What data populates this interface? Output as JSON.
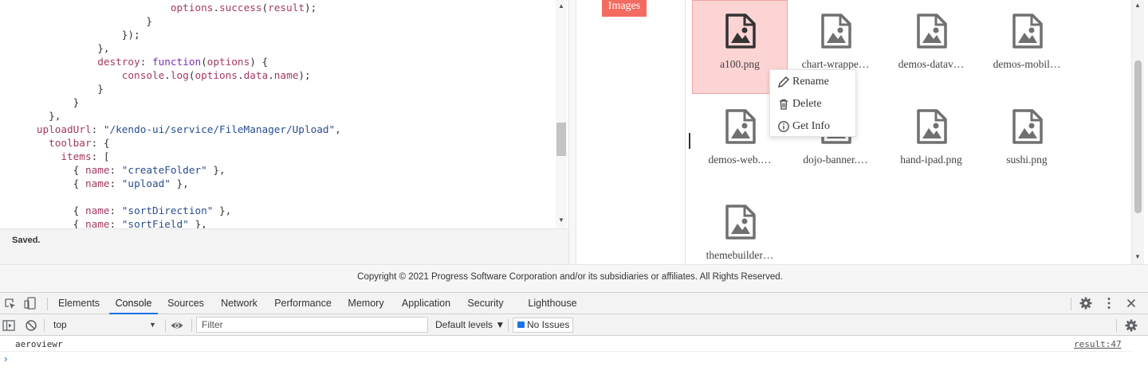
{
  "code_editor": {
    "lines": [
      [
        {
          "t": "                            ",
          "c": "plain"
        },
        {
          "t": "options",
          "c": "prop"
        },
        {
          "t": ".",
          "c": "plain"
        },
        {
          "t": "success",
          "c": "prop"
        },
        {
          "t": "(",
          "c": "plain"
        },
        {
          "t": "result",
          "c": "prop"
        },
        {
          "t": ");",
          "c": "plain"
        }
      ],
      [
        {
          "t": "                        }",
          "c": "plain"
        }
      ],
      [
        {
          "t": "                    });",
          "c": "plain"
        }
      ],
      [
        {
          "t": "                },",
          "c": "plain"
        }
      ],
      [
        {
          "t": "                ",
          "c": "plain"
        },
        {
          "t": "destroy",
          "c": "prop"
        },
        {
          "t": ": ",
          "c": "plain"
        },
        {
          "t": "function",
          "c": "key"
        },
        {
          "t": "(",
          "c": "plain"
        },
        {
          "t": "options",
          "c": "prop"
        },
        {
          "t": ") {",
          "c": "plain"
        }
      ],
      [
        {
          "t": "                    ",
          "c": "plain"
        },
        {
          "t": "console",
          "c": "prop"
        },
        {
          "t": ".",
          "c": "plain"
        },
        {
          "t": "log",
          "c": "prop"
        },
        {
          "t": "(",
          "c": "plain"
        },
        {
          "t": "options",
          "c": "prop"
        },
        {
          "t": ".",
          "c": "plain"
        },
        {
          "t": "data",
          "c": "prop"
        },
        {
          "t": ".",
          "c": "plain"
        },
        {
          "t": "name",
          "c": "prop"
        },
        {
          "t": ");",
          "c": "plain"
        }
      ],
      [
        {
          "t": "                }",
          "c": "plain"
        }
      ],
      [
        {
          "t": "            }",
          "c": "plain"
        }
      ],
      [
        {
          "t": "        },",
          "c": "plain"
        }
      ],
      [
        {
          "t": "      ",
          "c": "plain"
        },
        {
          "t": "uploadUrl",
          "c": "prop"
        },
        {
          "t": ": ",
          "c": "plain"
        },
        {
          "t": "\"/kendo-ui/service/FileManager/Upload\"",
          "c": "str"
        },
        {
          "t": ",",
          "c": "plain"
        }
      ],
      [
        {
          "t": "        ",
          "c": "plain"
        },
        {
          "t": "toolbar",
          "c": "prop"
        },
        {
          "t": ": {",
          "c": "plain"
        }
      ],
      [
        {
          "t": "          ",
          "c": "plain"
        },
        {
          "t": "items",
          "c": "prop"
        },
        {
          "t": ": [",
          "c": "plain"
        }
      ],
      [
        {
          "t": "            { ",
          "c": "plain"
        },
        {
          "t": "name",
          "c": "prop"
        },
        {
          "t": ": ",
          "c": "plain"
        },
        {
          "t": "\"createFolder\"",
          "c": "str"
        },
        {
          "t": " },",
          "c": "plain"
        }
      ],
      [
        {
          "t": "            { ",
          "c": "plain"
        },
        {
          "t": "name",
          "c": "prop"
        },
        {
          "t": ": ",
          "c": "plain"
        },
        {
          "t": "\"upload\"",
          "c": "str"
        },
        {
          "t": " },",
          "c": "plain"
        }
      ],
      [
        {
          "t": "",
          "c": "plain"
        }
      ],
      [
        {
          "t": "            { ",
          "c": "plain"
        },
        {
          "t": "name",
          "c": "prop"
        },
        {
          "t": ": ",
          "c": "plain"
        },
        {
          "t": "\"sortDirection\"",
          "c": "str"
        },
        {
          "t": " },",
          "c": "plain"
        }
      ],
      [
        {
          "t": "            { ",
          "c": "plain"
        },
        {
          "t": "name",
          "c": "prop"
        },
        {
          "t": ": ",
          "c": "plain"
        },
        {
          "t": "\"sortField\"",
          "c": "str"
        },
        {
          "t": " },",
          "c": "plain"
        }
      ]
    ],
    "status": "Saved."
  },
  "file_manager": {
    "folder_chip": "Images",
    "files": [
      {
        "name": "a100.png",
        "selected": true
      },
      {
        "name": "chart-wrappe…",
        "selected": false
      },
      {
        "name": "demos-datav…",
        "selected": false
      },
      {
        "name": "demos-mobil…",
        "selected": false
      },
      {
        "name": "demos-web.…",
        "selected": false
      },
      {
        "name": "dojo-banner.…",
        "selected": false
      },
      {
        "name": "hand-ipad.png",
        "selected": false
      },
      {
        "name": "sushi.png",
        "selected": false
      },
      {
        "name": "themebuilder…",
        "selected": false
      }
    ],
    "file_icon": "image-file-icon",
    "context_menu": [
      {
        "label": "Rename",
        "icon": "pencil-icon"
      },
      {
        "label": "Delete",
        "icon": "trash-icon"
      },
      {
        "label": "Get Info",
        "icon": "info-icon"
      }
    ]
  },
  "footer": {
    "copyright": "Copyright © 2021 Progress Software Corporation and/or its subsidiaries or affiliates. All Rights Reserved."
  },
  "devtools": {
    "tabs": [
      "Elements",
      "Console",
      "Sources",
      "Network",
      "Performance",
      "Memory",
      "Application",
      "Security",
      "Lighthouse"
    ],
    "active_tab": "Console",
    "context": "top",
    "filter_placeholder": "Filter",
    "levels": "Default levels ▼",
    "issues": "No Issues",
    "log": {
      "text": "aeroviewr",
      "source": "result:47"
    },
    "colors": {
      "accent": "#1a73e8",
      "chip": "#f36b60",
      "selected_tile": "#fdd4d4"
    }
  }
}
